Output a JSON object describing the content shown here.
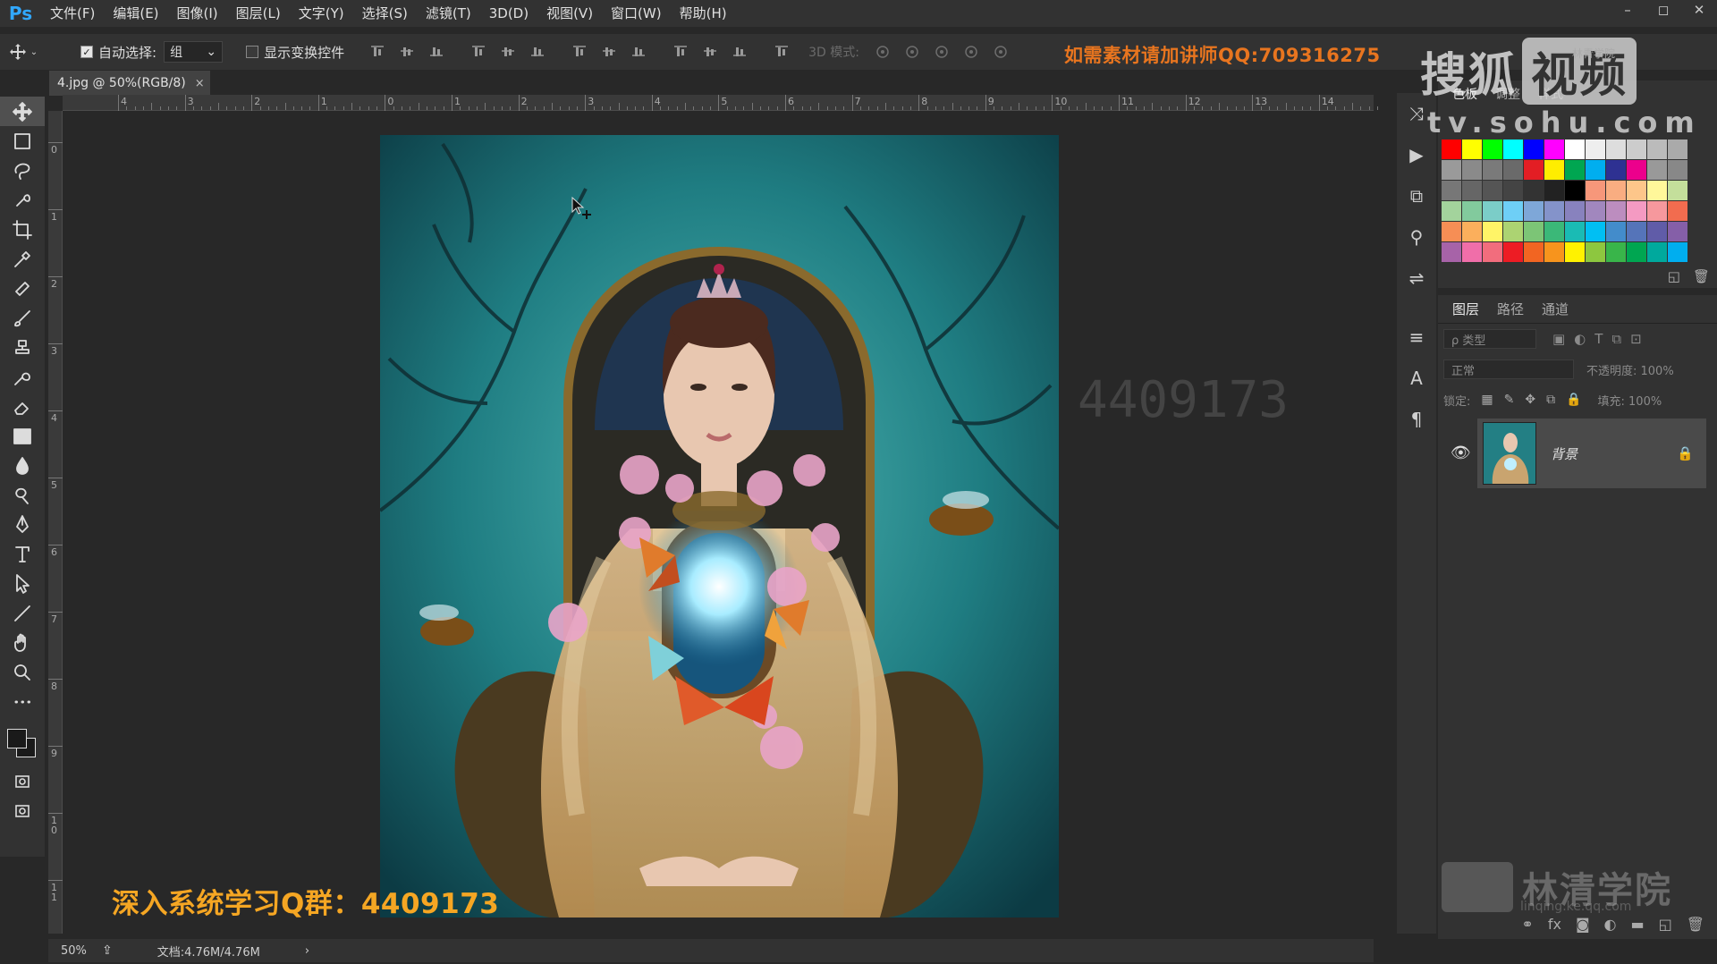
{
  "app": {
    "logo": "Ps"
  },
  "menu": [
    "文件(F)",
    "编辑(E)",
    "图像(I)",
    "图层(L)",
    "文字(Y)",
    "选择(S)",
    "滤镜(T)",
    "3D(D)",
    "视图(V)",
    "窗口(W)",
    "帮助(H)"
  ],
  "window_controls": {
    "minimize": "–",
    "restore": "◻",
    "close": "✕"
  },
  "options": {
    "auto_select_label": "自动选择:",
    "auto_select_value": "组",
    "show_transform_label": "显示变换控件",
    "mode_3d_label": "3D 模式:",
    "promo_text": "如需素材请加讲师QQ:709316275"
  },
  "document": {
    "tab_title": "4.jpg @ 50%(RGB/8)",
    "close_symbol": "×"
  },
  "ruler": {
    "h_labels": [
      "4",
      "3",
      "2",
      "1",
      "0",
      "1",
      "2",
      "3",
      "4",
      "5",
      "6",
      "7",
      "8",
      "9",
      "10",
      "11",
      "12",
      "13",
      "14"
    ],
    "v_labels": [
      "0",
      "1",
      "2",
      "3",
      "4",
      "5",
      "6",
      "7",
      "8",
      "9",
      "1\n0",
      "1\n1"
    ]
  },
  "canvas": {
    "watermark_qgroup": "深入系统学习Q群：4409173",
    "ghost_number": "4409173"
  },
  "status": {
    "zoom": "50%",
    "doc_size": "文档:4.76M/4.76M",
    "arrow": "›"
  },
  "overlay": {
    "sohu_text": "搜狐",
    "sohu_box": "视频",
    "sohu_url": "tv.sohu.com",
    "small_label": "林青学院"
  },
  "swatches_panel": {
    "tabs": [
      "色板",
      "调整",
      "样式"
    ],
    "colors": [
      "#ff0000",
      "#ffff00",
      "#00ff00",
      "#00ffff",
      "#0000ff",
      "#ff00ff",
      "#ffffff",
      "#eeeeee",
      "#dddddd",
      "#cccccc",
      "#bbbbbb",
      "#aaaaaa",
      "#9a9a9a",
      "#8a8a8a",
      "#7a7a7a",
      "#6a6a6a",
      "#e31e24",
      "#ffed00",
      "#00a651",
      "#00aeef",
      "#2e3192",
      "#ec008c",
      "#999999",
      "#888888",
      "#777777",
      "#666666",
      "#555555",
      "#444444",
      "#333333",
      "#222222",
      "#000000",
      "#f7977a",
      "#f9ad81",
      "#fdc68a",
      "#fff79a",
      "#c4df9b",
      "#a3d39c",
      "#82ca9d",
      "#7bcdc8",
      "#6ecff6",
      "#7ea7d8",
      "#8493ca",
      "#8882be",
      "#a187be",
      "#bc8dbf",
      "#f49ac2",
      "#f6989d",
      "#f26c4f",
      "#f68e55",
      "#fbaf5c",
      "#fff467",
      "#acd372",
      "#7cc576",
      "#3bb878",
      "#1abbb4",
      "#00bff3",
      "#438ccb",
      "#5574b9",
      "#605ca8",
      "#855fa8",
      "#a763a8",
      "#f06ea9",
      "#f26d7d",
      "#ed1c24",
      "#f26522",
      "#f7941d",
      "#fff200",
      "#8dc73f",
      "#39b54a",
      "#00a651",
      "#00a99d",
      "#00aeef"
    ],
    "footer_icons": [
      "◱",
      "🗑"
    ]
  },
  "layers_panel": {
    "tabs": [
      "图层",
      "路径",
      "通道"
    ],
    "filter_label": "ρ 类型",
    "blend_mode": "正常",
    "opacity_label": "不透明度: 100%",
    "lock_label": "锁定:",
    "fill_label": "填充: 100%",
    "layer_name": "背景",
    "footer_icons": [
      "⚭",
      "fx",
      "◙",
      "◐",
      "▬",
      "◱",
      "🗑"
    ]
  },
  "brand": {
    "text": "林清学院",
    "sub": "linqing.ke.qq.com"
  }
}
